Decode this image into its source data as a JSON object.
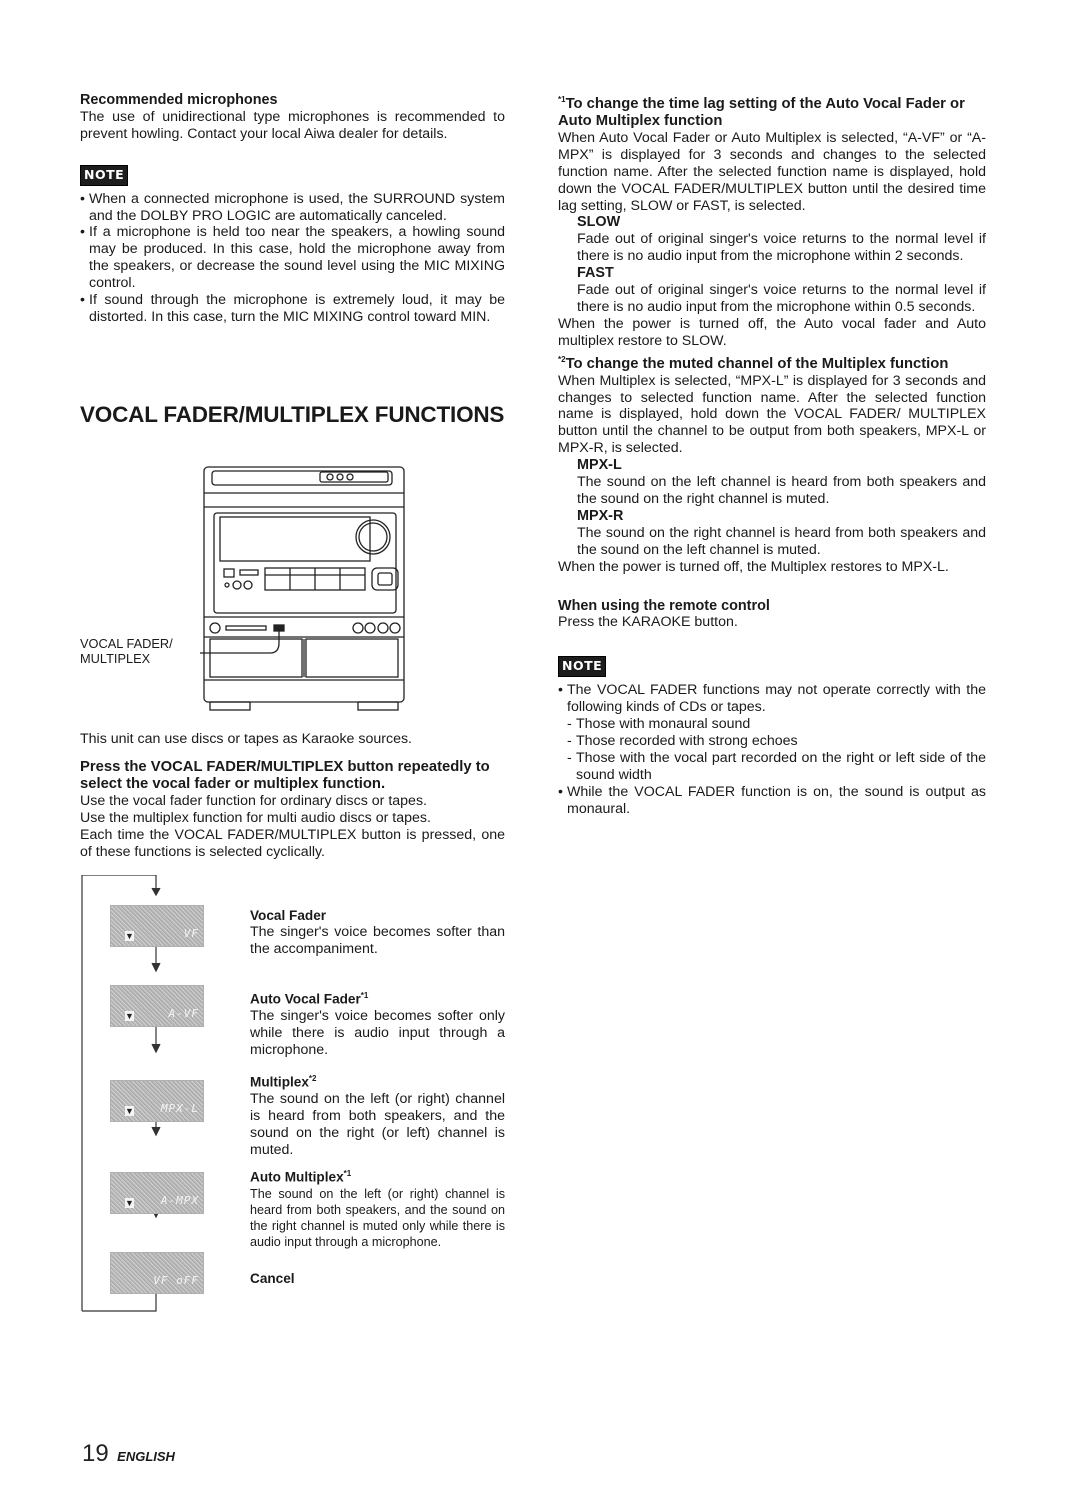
{
  "left": {
    "rec_mic_title": "Recommended microphones",
    "rec_mic_body": "The use of unidirectional type microphones is recommended to prevent howling. Contact your local Aiwa dealer for details.",
    "note_label": "NOTE",
    "notes": [
      "When a connected microphone is used, the SURROUND system and the DOLBY PRO LOGIC are automatically canceled.",
      "If a microphone is held too near the speakers, a howling sound may be produced.  In this case, hold the microphone away from the speakers, or decrease the sound level using the MIC MIXING control.",
      "If sound through the microphone is extremely loud, it may be distorted.  In this case, turn the MIC MIXING control toward MIN."
    ],
    "section_title": "VOCAL FADER/MULTIPLEX FUNCTIONS",
    "callout_line1": "VOCAL FADER/",
    "callout_line2": "MULTIPLEX",
    "intro": "This unit can use discs or tapes as Karaoke sources.",
    "instruction": "Press the VOCAL FADER/MULTIPLEX button repeatedly to select the vocal fader or multiplex function.",
    "body_lines": [
      "Use the vocal fader function for ordinary discs or tapes.",
      "Use the multiplex function for multi audio discs or tapes.",
      "Each time the VOCAL FADER/MULTIPLEX button is pressed, one of these functions is selected cyclically."
    ],
    "flow": [
      {
        "display": "VF",
        "title": "Vocal Fader",
        "sup": "",
        "desc": "The singer's voice becomes softer than the accompaniment."
      },
      {
        "display": "A-VF",
        "title": "Auto Vocal Fader",
        "sup": "*1",
        "desc": "The singer's voice becomes softer only while there is audio input through a microphone."
      },
      {
        "display": "MPX-L",
        "title": "Multiplex",
        "sup": "*2",
        "desc": "The sound on the left (or right) channel is heard from both speakers, and the sound on the right (or left) channel is muted."
      },
      {
        "display": "A-MPX",
        "title": "Auto Multiplex",
        "sup": "*1",
        "desc": "The sound on the left (or right) channel is heard from both speakers, and the sound on the right channel is muted only while there is audio input through a microphone."
      },
      {
        "display": "VF oFF",
        "title": "Cancel",
        "sup": "",
        "desc": ""
      }
    ]
  },
  "right": {
    "fn1_sup": "*1",
    "fn1_title": "To change the time lag setting of the Auto Vocal Fader or Auto Multiplex function",
    "fn1_body": "When Auto Vocal Fader or Auto Multiplex is selected, “A-VF” or “A-MPX” is displayed for 3 seconds and changes to the selected function name. After the selected function name is displayed, hold down the VOCAL FADER/MULTIPLEX button until the desired time lag setting, SLOW or FAST, is selected.",
    "slow_title": "SLOW",
    "slow_body": "Fade out of original singer's voice returns to the normal level if there is no audio input from the microphone within 2 seconds.",
    "fast_title": "FAST",
    "fast_body": "Fade out of original singer's voice returns to the normal level if there is no audio input from the microphone within 0.5 seconds.",
    "fn1_footer": "When the power is turned off, the Auto vocal fader and Auto multiplex restore to SLOW.",
    "fn2_sup": "*2",
    "fn2_title": "To change the muted channel of the Multiplex function",
    "fn2_body": "When Multiplex is selected, “MPX-L” is displayed for 3 seconds and changes to selected function name. After the selected function name is displayed, hold down the VOCAL FADER/ MULTIPLEX button until the channel to be output from both speakers, MPX-L or MPX-R, is selected.",
    "mpxl_title": "MPX-L",
    "mpxl_body": "The sound on the left channel is heard from both speakers and the sound on the right channel is muted.",
    "mpxr_title": "MPX-R",
    "mpxr_body": "The sound on the right channel is heard from both speakers and the sound on the left channel is muted.",
    "fn2_footer": "When the power is turned off, the Multiplex restores to MPX-L.",
    "remote_title": "When using the remote control",
    "remote_body": "Press the KARAOKE button.",
    "note_label": "NOTE",
    "note1": "The VOCAL FADER functions may not operate correctly with the following kinds of CDs or tapes.",
    "note1_items": [
      "Those with monaural sound",
      "Those recorded with strong echoes",
      "Those with the vocal part recorded on the right or left side of the sound  width"
    ],
    "note2": "While the VOCAL FADER function is on, the sound is output as monaural."
  },
  "footer": {
    "page_number": "19",
    "language": "ENGLISH"
  }
}
